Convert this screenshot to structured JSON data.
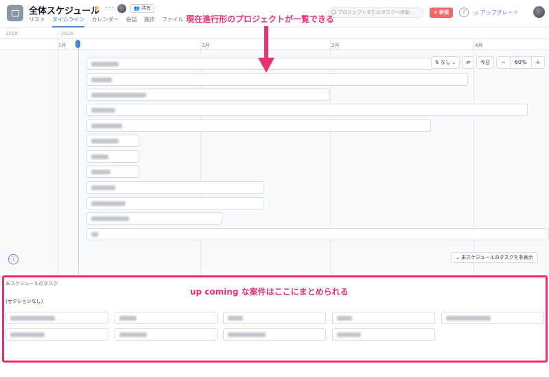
{
  "header": {
    "title": "全体スケジュール",
    "share_label": "共有",
    "tabs": [
      "リスト",
      "タイムライン",
      "カレンダー",
      "会話",
      "進捗",
      "ファイル"
    ],
    "active_tab": "タイムライン",
    "search_placeholder": "プロジェクトまたはタスクへ移動...",
    "new_button": "+ 新規",
    "help_label": "?",
    "upgrade_label": "アップグレード"
  },
  "timeline": {
    "years": [
      "2018",
      "2019"
    ],
    "months": [
      "1月",
      "2月",
      "3月",
      "4月"
    ],
    "controls": {
      "sort_label": "⇅ なし",
      "today_label": "今日",
      "zoom_out": "−",
      "zoom_level": "60%",
      "zoom_in": "+"
    },
    "hide_unscheduled_label": "未スケジュールのタスクを非表示",
    "info_label": "ⓘ"
  },
  "unscheduled": {
    "title": "未スケジュールのタスク",
    "section_label": "(セクションなし)"
  },
  "annotations": {
    "top_text": "現在進行形のプロジェクトが一覧できる",
    "bottom_text": "up coming な案件はここにまとめられる"
  },
  "colors": {
    "accent_blue": "#4186e0",
    "annotation_pink": "#e8336d",
    "new_button": "#f06a6a",
    "upgrade_purple": "#7a6ff0"
  }
}
